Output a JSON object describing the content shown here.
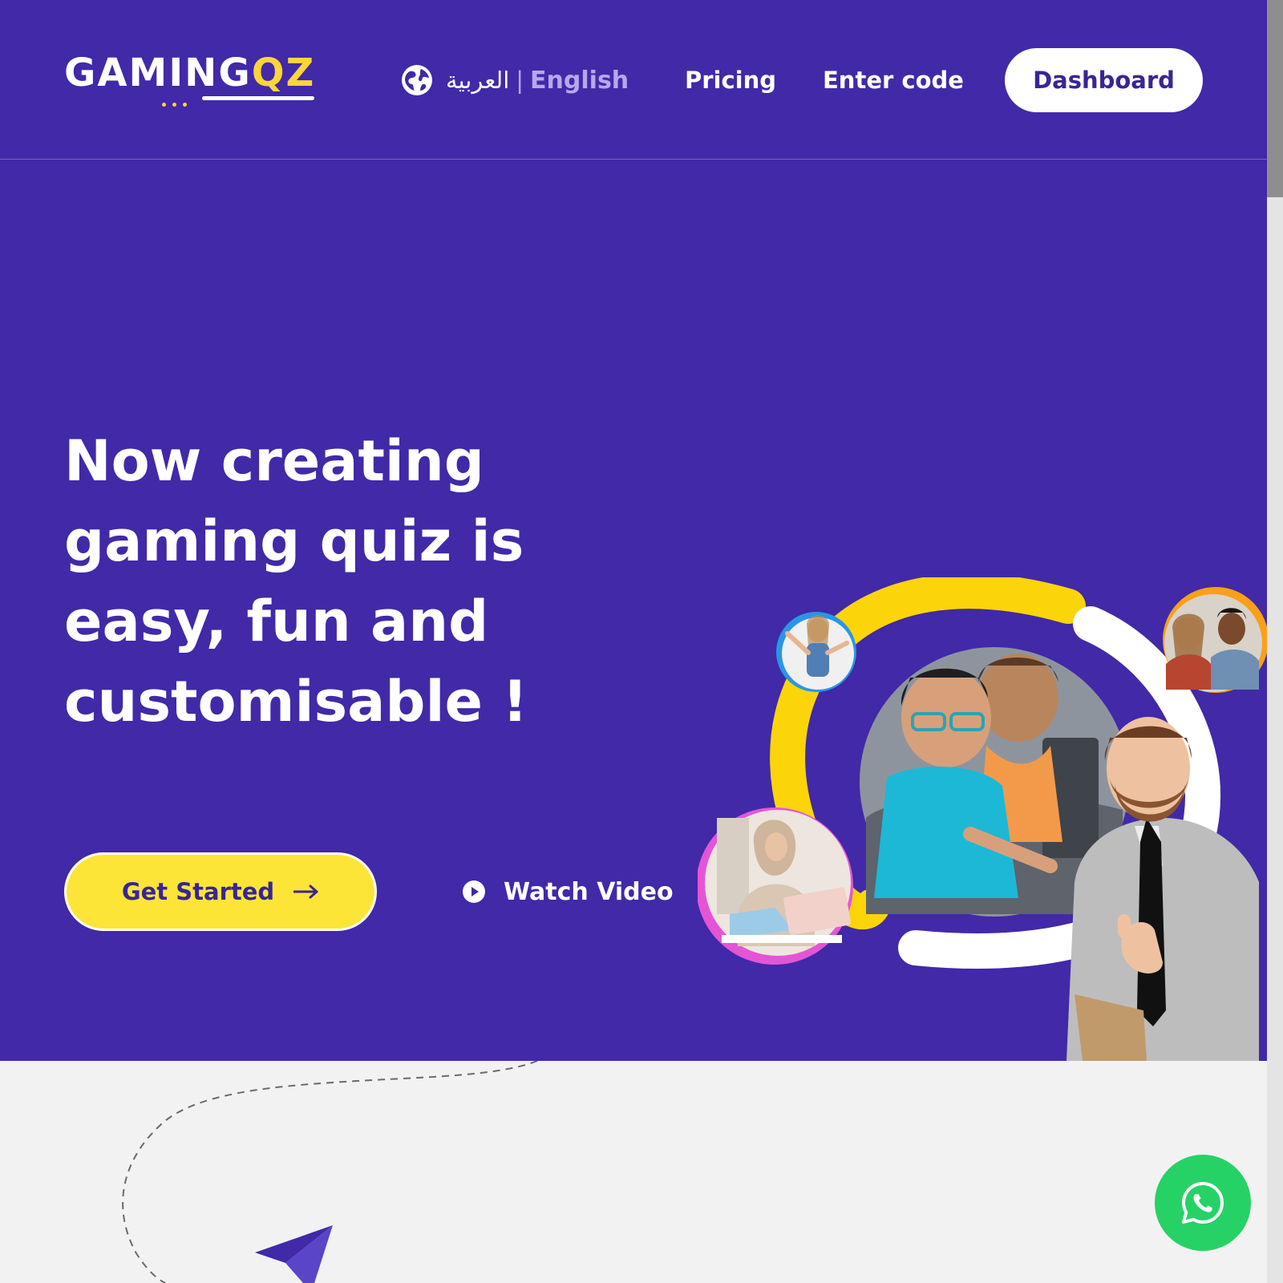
{
  "brand": {
    "logo_text": "GAMING",
    "logo_accent": "QZ",
    "primary_color": "#4129a8",
    "accent_color": "#fcd53a"
  },
  "header": {
    "language": {
      "arabic_label": "العربية",
      "separator": "|",
      "english_label": "English",
      "icon": "globe-icon"
    },
    "nav": {
      "pricing": "Pricing",
      "enter_code": "Enter code"
    },
    "dashboard_label": "Dashboard"
  },
  "hero": {
    "headline": "Now creating gaming quiz is easy, fun and customisable !",
    "cta_label": "Get Started",
    "cta_icon": "arrow-right-icon",
    "watch_label": "Watch Video",
    "watch_icon": "play-icon"
  },
  "floating": {
    "whatsapp_icon": "whatsapp-icon",
    "whatsapp_color": "#26d266"
  }
}
